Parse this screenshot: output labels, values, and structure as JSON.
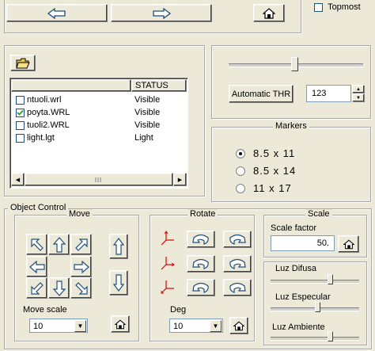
{
  "window": {
    "topmost_label": "Topmost",
    "topmost_checked": false
  },
  "nav": {
    "back_icon": "arrow-left-icon",
    "forward_icon": "arrow-right-icon",
    "home_icon": "home-icon"
  },
  "threshold": {
    "button_label": "Automatic THR",
    "value": "123",
    "slider_fraction": 0.48
  },
  "files": {
    "open_icon": "folder-open-icon",
    "columns": [
      "",
      "STATUS"
    ],
    "rows": [
      {
        "name": "ntuoli.wrl",
        "status": "Visible",
        "checked": false
      },
      {
        "name": "poyta.WRL",
        "status": "Visible",
        "checked": true
      },
      {
        "name": "tuoli2.WRL",
        "status": "Visible",
        "checked": false
      },
      {
        "name": "light.lgt",
        "status": "Light",
        "checked": false
      }
    ]
  },
  "markers": {
    "title": "Markers",
    "options": [
      {
        "label": "8.5 x 11",
        "selected": true
      },
      {
        "label": "8.5 x 14",
        "selected": false
      },
      {
        "label": "11 x 17",
        "selected": false
      }
    ]
  },
  "object_control": {
    "title": "Object Control",
    "move": {
      "title": "Move",
      "scale_label": "Move scale",
      "scale_value": "10"
    },
    "rotate": {
      "title": "Rotate",
      "deg_label": "Deg",
      "deg_value": "10"
    },
    "scale": {
      "title": "Scale",
      "factor_label": "Scale factor",
      "factor_value": "50."
    },
    "lights": {
      "diffuse_label": "Luz Difusa",
      "diffuse_fraction": 0.55,
      "specular_label": "Luz Especular",
      "specular_fraction": 0.38,
      "ambient_label": "Luz Ambiente",
      "ambient_fraction": 0.55
    }
  }
}
